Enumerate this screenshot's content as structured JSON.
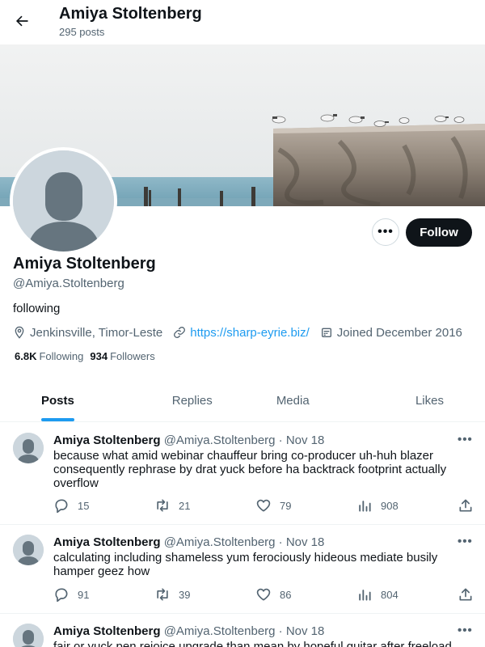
{
  "header": {
    "title": "Amiya Stoltenberg",
    "post_count": "295 posts"
  },
  "profile": {
    "name": "Amiya Stoltenberg",
    "handle": "@Amiya.Stoltenberg",
    "bio": "following",
    "location": "Jenkinsville, Timor-Leste",
    "website": "https://sharp-eyrie.biz/",
    "joined": "Joined December 2016",
    "following_count": "6.8K",
    "following_label": "Following",
    "followers_count": "934",
    "followers_label": "Followers",
    "follow_label": "Follow",
    "more_label": "•••"
  },
  "tabs": [
    {
      "label": "Posts",
      "active": true
    },
    {
      "label": "Replies",
      "active": false
    },
    {
      "label": "Media",
      "active": false
    },
    {
      "label": "Likes",
      "active": false
    }
  ],
  "tweets": [
    {
      "name": "Amiya Stoltenberg",
      "handle": "@Amiya.Stoltenberg",
      "dot": "·",
      "date": "Nov 18",
      "more": "•••",
      "text": "because what amid webinar chauffeur bring co-producer uh-huh blazer consequently rephrase by drat yuck before ha backtrack footprint actually overflow",
      "replies": "15",
      "reposts": "21",
      "likes": "79",
      "views": "908"
    },
    {
      "name": "Amiya Stoltenberg",
      "handle": "@Amiya.Stoltenberg",
      "dot": "·",
      "date": "Nov 18",
      "more": "•••",
      "text": "calculating including shameless yum ferociously hideous mediate busily hamper geez how",
      "replies": "91",
      "reposts": "39",
      "likes": "86",
      "views": "804"
    },
    {
      "name": "Amiya Stoltenberg",
      "handle": "@Amiya.Stoltenberg",
      "dot": "·",
      "date": "Nov 18",
      "more": "•••",
      "text": "fair or yuck pen rejoice upgrade than mean by hopeful guitar after freeload",
      "replies": "",
      "reposts": "",
      "likes": "",
      "views": ""
    }
  ],
  "icons": {
    "back": "arrow-left-icon",
    "location": "location-pin-icon",
    "link": "link-icon",
    "calendar": "calendar-icon",
    "reply": "reply-icon",
    "repost": "repost-icon",
    "like": "heart-icon",
    "views": "bar-chart-icon",
    "share": "share-icon"
  },
  "colors": {
    "accent": "#1d9bf0",
    "text": "#0f1419",
    "muted": "#536471",
    "avatar_bg": "#ccd6dd",
    "follow_bg": "#0f1419"
  }
}
